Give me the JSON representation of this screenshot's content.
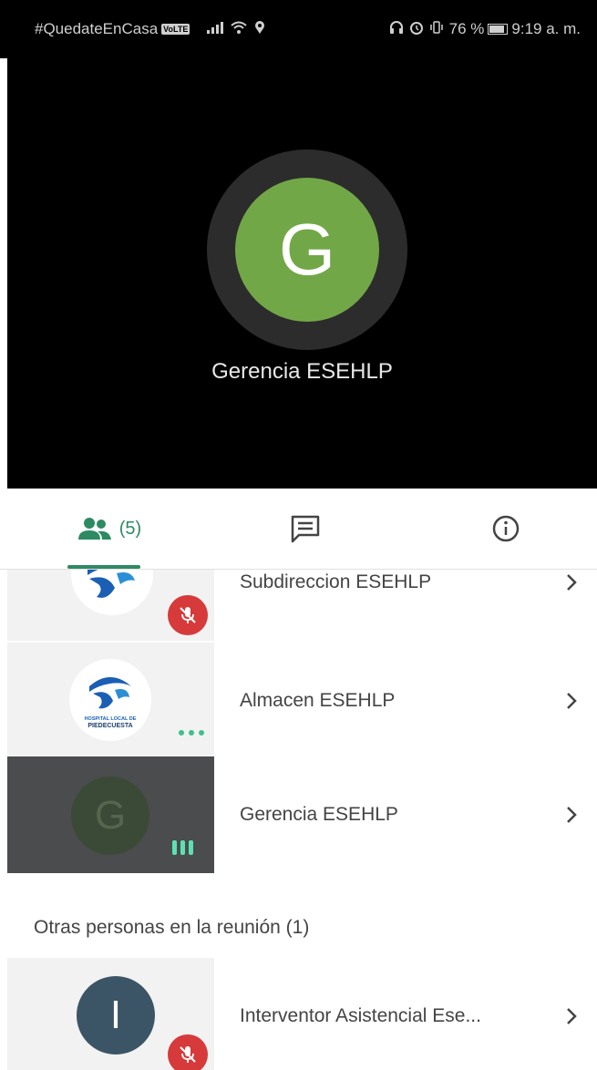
{
  "status_bar": {
    "hashtag": "#QuedateEnCasa",
    "volte": "VoLTE",
    "battery": "76 %",
    "time": "9:19 a. m."
  },
  "stage": {
    "avatar_initial": "G",
    "speaker_name": "Gerencia ESEHLP",
    "avatar_color": "#72a747"
  },
  "tabs": {
    "participants_count": "(5)",
    "accent_color": "#2d8a63"
  },
  "participants": [
    {
      "name": "Subdireccion ESEHLP",
      "mic": "muted"
    },
    {
      "name": "Almacen ESEHLP",
      "logo_text": "HOSPITAL LOCAL DE PIEDECUESTA",
      "status": "connecting"
    },
    {
      "name": "Gerencia ESEHLP",
      "avatar_initial": "G",
      "status": "speaking"
    }
  ],
  "others_section": {
    "label": "Otras personas en la reunión (1)",
    "people": [
      {
        "name": "Interventor Asistencial Ese...",
        "avatar_initial": "I",
        "avatar_color": "#3b5566",
        "mic": "muted"
      }
    ]
  }
}
